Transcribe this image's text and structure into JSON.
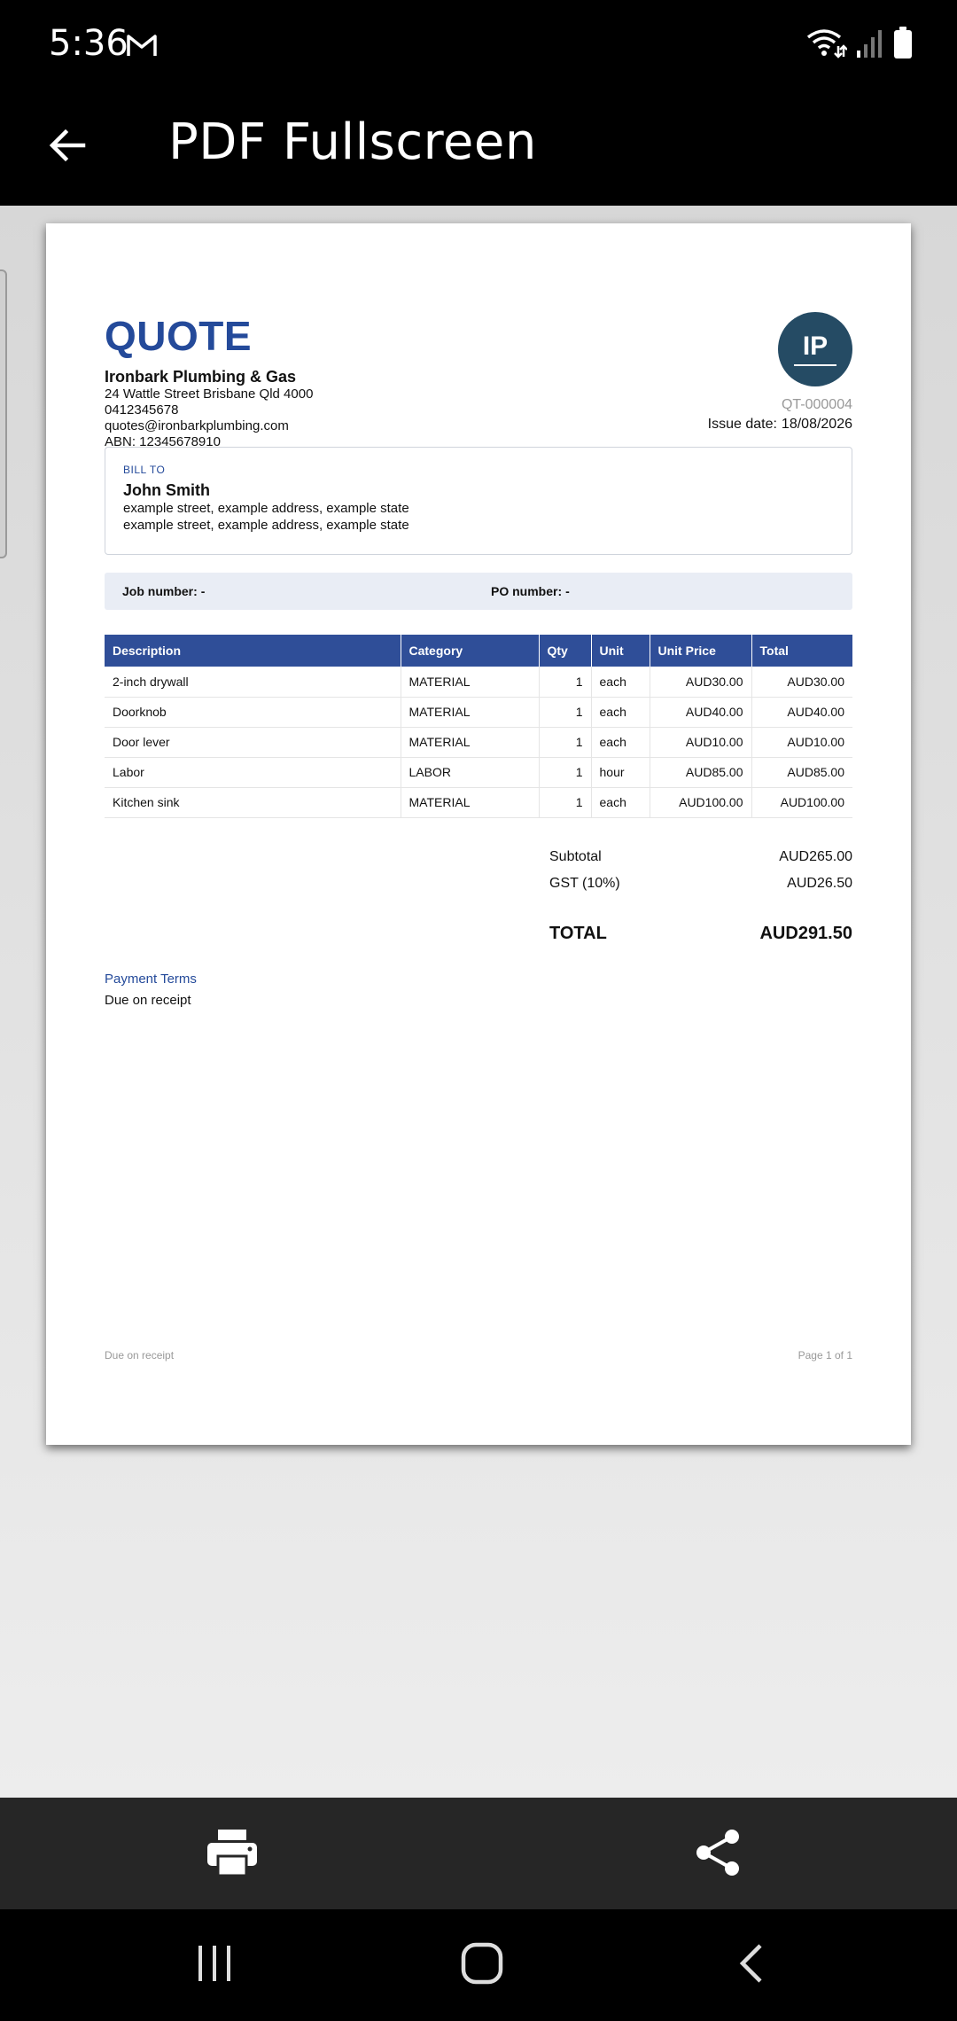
{
  "status_bar": {
    "time": "5:36",
    "icons": [
      "gmail-icon",
      "wifi-icon",
      "signal-icon",
      "battery-icon"
    ]
  },
  "app_bar": {
    "title": "PDF Fullscreen",
    "back_icon": "arrow-left-icon"
  },
  "document": {
    "title": "QUOTE",
    "company": {
      "name": "Ironbark Plumbing & Gas",
      "address": "24 Wattle Street Brisbane Qld 4000",
      "phone": "0412345678",
      "email": "quotes@ironbarkplumbing.com",
      "abn": "ABN: 12345678910"
    },
    "logo_text": "IP",
    "logo_color": "#254b64",
    "quote_number": "QT-000004",
    "issue_date_label": "Issue date:",
    "issue_date": "18/08/2026",
    "bill_to": {
      "heading": "BILL TO",
      "name": "John Smith",
      "lines": [
        "example street, example address, example state",
        "example street, example address, example state"
      ]
    },
    "job_number_label": "Job number:",
    "job_number": "-",
    "po_number_label": "PO number:",
    "po_number": "-",
    "table": {
      "headers": [
        "Description",
        "Category",
        "Qty",
        "Unit",
        "Unit Price",
        "Total"
      ],
      "rows": [
        [
          "2-inch drywall",
          "MATERIAL",
          "1",
          "each",
          "AUD30.00",
          "AUD30.00"
        ],
        [
          "Doorknob",
          "MATERIAL",
          "1",
          "each",
          "AUD40.00",
          "AUD40.00"
        ],
        [
          "Door lever",
          "MATERIAL",
          "1",
          "each",
          "AUD10.00",
          "AUD10.00"
        ],
        [
          "Labor",
          "LABOR",
          "1",
          "hour",
          "AUD85.00",
          "AUD85.00"
        ],
        [
          "Kitchen sink",
          "MATERIAL",
          "1",
          "each",
          "AUD100.00",
          "AUD100.00"
        ]
      ],
      "header_color": "#2f4e98"
    },
    "totals": {
      "subtotal_label": "Subtotal",
      "subtotal": "AUD265.00",
      "gst_label": "GST (10%)",
      "gst": "AUD26.50",
      "total_label": "TOTAL",
      "total": "AUD291.50"
    },
    "payment_terms": {
      "heading": "Payment Terms",
      "text": "Due on receipt"
    },
    "footer": {
      "left": "Due on receipt",
      "right": "Page 1 of 1"
    },
    "accent_color": "#244a9a"
  },
  "actions": {
    "print_icon": "print-icon",
    "share_icon": "share-icon"
  },
  "nav": {
    "icons": [
      "recent-apps-icon",
      "home-icon",
      "back-icon"
    ]
  }
}
